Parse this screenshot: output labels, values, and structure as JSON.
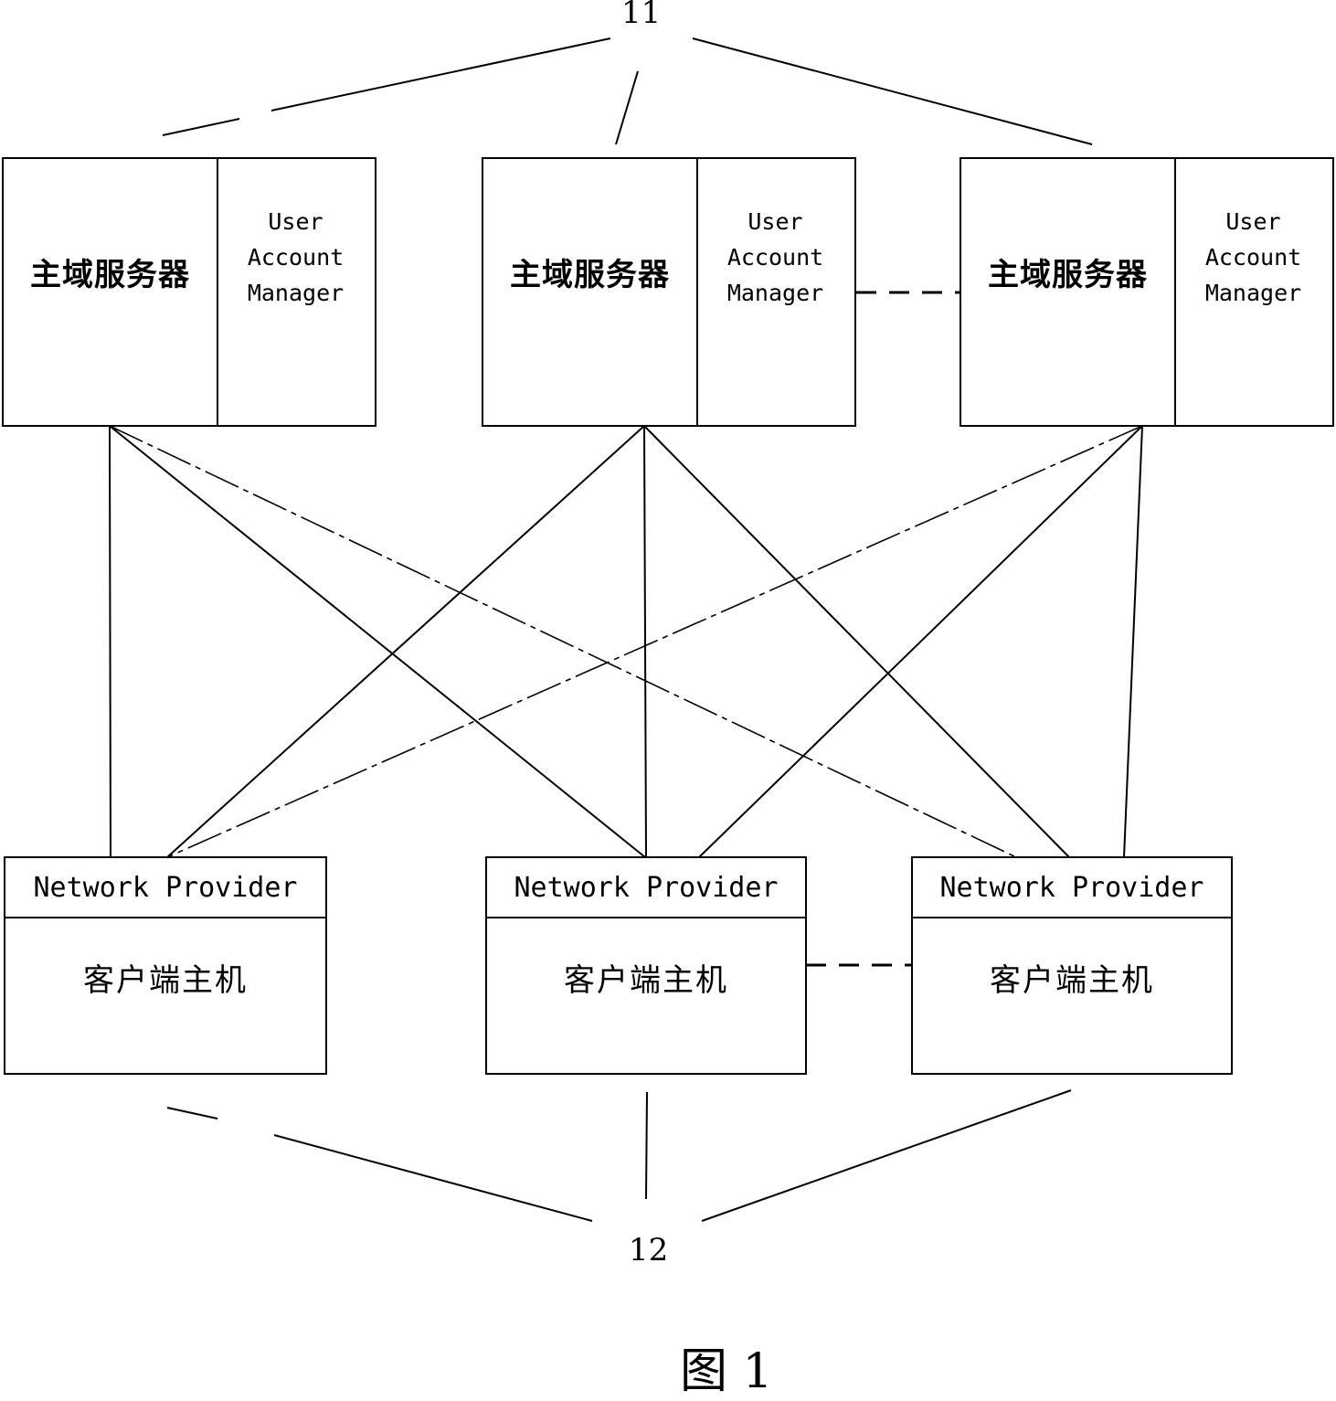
{
  "servers": [
    {
      "name": "主域服务器",
      "module": [
        "User",
        "Account",
        "Manager"
      ]
    },
    {
      "name": "主域服务器",
      "module": [
        "User",
        "Account",
        "Manager"
      ]
    },
    {
      "name": "主域服务器",
      "module": [
        "User",
        "Account",
        "Manager"
      ]
    }
  ],
  "clients": [
    {
      "provider": "Network Provider",
      "name": "客户端主机"
    },
    {
      "provider": "Network Provider",
      "name": "客户端主机"
    },
    {
      "provider": "Network Provider",
      "name": "客户端主机"
    }
  ],
  "labels": {
    "server_group": "11",
    "client_group": "12"
  },
  "caption": "图 1",
  "connections": [
    {
      "from": "server-1",
      "to": "client-1",
      "style": "solid"
    },
    {
      "from": "server-1",
      "to": "client-2",
      "style": "solid"
    },
    {
      "from": "server-1",
      "to": "client-3",
      "style": "dash-dot"
    },
    {
      "from": "server-2",
      "to": "client-1",
      "style": "solid"
    },
    {
      "from": "server-2",
      "to": "client-2",
      "style": "solid"
    },
    {
      "from": "server-2",
      "to": "client-3",
      "style": "solid"
    },
    {
      "from": "server-3",
      "to": "client-1",
      "style": "dash-dot"
    },
    {
      "from": "server-3",
      "to": "client-2",
      "style": "solid"
    },
    {
      "from": "server-3",
      "to": "client-3",
      "style": "solid"
    },
    {
      "from": "server-2",
      "to": "server-3",
      "style": "dashed"
    },
    {
      "from": "client-2",
      "to": "client-3",
      "style": "dashed"
    }
  ]
}
